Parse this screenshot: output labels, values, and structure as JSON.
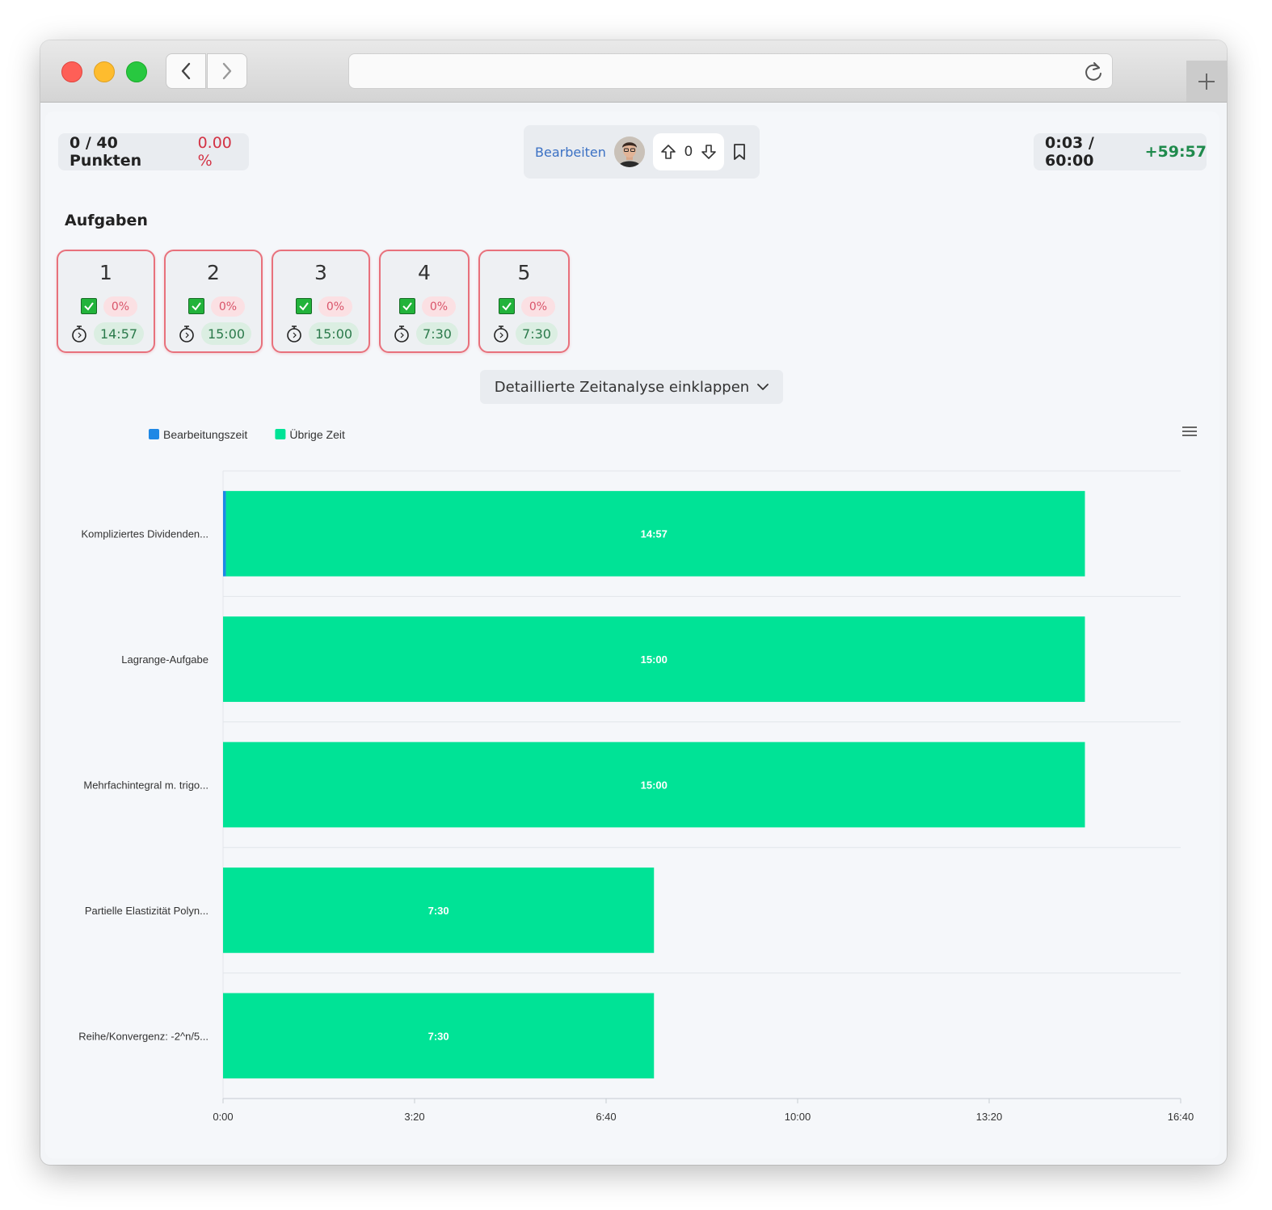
{
  "header": {
    "score": {
      "label": "0 / 40 Punkten",
      "percent": "0.00 %"
    },
    "edit_label": "Bearbeiten",
    "vote_count": "0",
    "timer": {
      "elapsed": "0:03 / 60:00",
      "remaining": "+59:57"
    }
  },
  "section_title": "Aufgaben",
  "tasks": [
    {
      "num": "1",
      "percent": "0%",
      "time": "14:57"
    },
    {
      "num": "2",
      "percent": "0%",
      "time": "15:00"
    },
    {
      "num": "3",
      "percent": "0%",
      "time": "15:00"
    },
    {
      "num": "4",
      "percent": "0%",
      "time": "7:30"
    },
    {
      "num": "5",
      "percent": "0%",
      "time": "7:30"
    }
  ],
  "collapse_label": "Detaillierte Zeitanalyse einklappen",
  "colors": {
    "worked": "#1e88e5",
    "remaining": "#00e396",
    "card_border": "#e8717c",
    "accent_link": "#3b71c4"
  },
  "chart_data": {
    "type": "bar",
    "orientation": "horizontal",
    "stacked": true,
    "categories": [
      "Kompliziertes Dividenden...",
      "Lagrange-Aufgabe",
      "Mehrfachintegral m. trigo...",
      "Partielle Elastizität Polyn...",
      "Reihe/Konvergenz: -2^n/5..."
    ],
    "series": [
      {
        "name": "Bearbeitungszeit",
        "color": "#1e88e5",
        "values": [
          3,
          0,
          0,
          0,
          0
        ]
      },
      {
        "name": "Übrige Zeit",
        "color": "#00e396",
        "values": [
          897,
          900,
          900,
          450,
          450
        ]
      }
    ],
    "data_labels": [
      "14:57",
      "15:00",
      "15:00",
      "7:30",
      "7:30"
    ],
    "unit": "seconds",
    "xlim": [
      0,
      1000
    ],
    "x_ticks": [
      {
        "value": 0,
        "label": "0:00"
      },
      {
        "value": 200,
        "label": "3:20"
      },
      {
        "value": 400,
        "label": "6:40"
      },
      {
        "value": 600,
        "label": "10:00"
      },
      {
        "value": 800,
        "label": "13:20"
      },
      {
        "value": 1000,
        "label": "16:40"
      }
    ],
    "legend_position": "top-left",
    "grid": true
  }
}
